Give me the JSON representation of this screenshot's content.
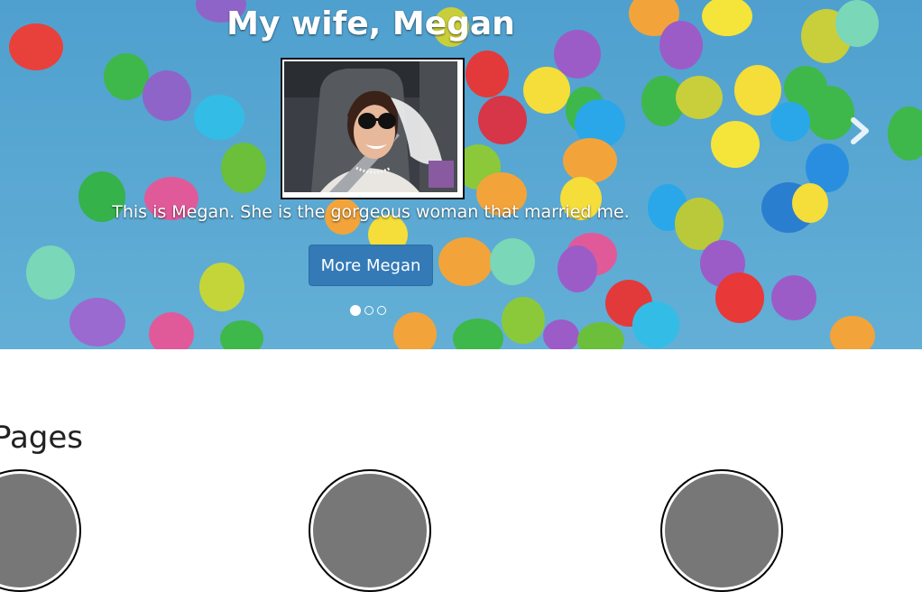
{
  "carousel": {
    "slide": {
      "title": "My wife, Megan",
      "caption": "This is Megan. She is the gorgeous woman that married me.",
      "button_label": "More Megan",
      "photo_alt": "Photo of Megan wearing sunglasses and a veil"
    },
    "indicators": [
      {
        "active": true
      },
      {
        "active": false
      },
      {
        "active": false
      }
    ],
    "next_icon": "chevron-right-icon",
    "background_color": "#5aa7d2"
  },
  "pages_section": {
    "heading": "Pages",
    "thumbnail_color": "#777777"
  }
}
